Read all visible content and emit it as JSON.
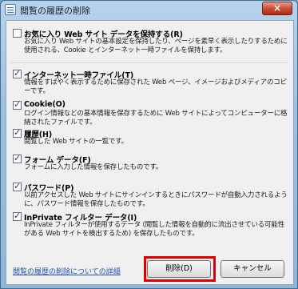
{
  "window": {
    "title": "閲覧の履歴の削除",
    "close_label": "×"
  },
  "items": [
    {
      "label": "お気に入り Web サイト データを保持する(R)",
      "checked": false,
      "description": "お気に入り Web サイトの基本設定を保持したり、ページを素早く表示したりするために使用される、Cookie とインターネット一時ファイルを保持します。"
    },
    {
      "label": "インターネット一時ファイル(T)",
      "checked": true,
      "description": "情報をすばやく表示するために保存された Web ページ、イメージおよびメディアのコピーです。"
    },
    {
      "label": "Cookie(O)",
      "checked": true,
      "description": "ログイン情報などの基本情報を保存するために Web サイトによってコンピューターに格納されたファイルです。"
    },
    {
      "label": "履歴(H)",
      "checked": true,
      "description": "閲覧した Web サイトの一覧です。"
    },
    {
      "label": "フォーム データ(F)",
      "checked": true,
      "description": "フォームに入力した情報を保存したものです。"
    },
    {
      "label": "パスワード(P)",
      "checked": true,
      "description": "以前アクセスした Web サイトにサインインするときにパスワードが自動入力されるように、パスワード情報を保存したものです。"
    },
    {
      "label": "InPrivate フィルター データ(I)",
      "checked": true,
      "description": "InPrivate フィルターが使用するデータ (閲覧した情報を自動的に流出させている可能性がある Web サイトを検出するため) を保存したものです。"
    }
  ],
  "footer": {
    "link_text": "閲覧の履歴の削除についての詳細",
    "delete_label": "削除(D)",
    "cancel_label": "キャンセル"
  }
}
